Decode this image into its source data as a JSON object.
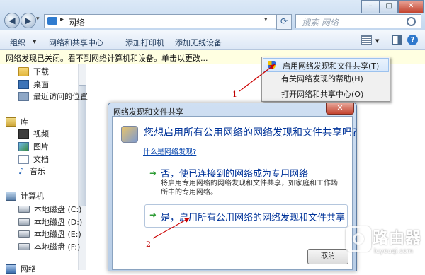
{
  "address_bar": {
    "path_label": "网络",
    "separator": "▸"
  },
  "search": {
    "placeholder": "搜索 网络"
  },
  "window_controls": {
    "minimize": "–",
    "maximize": "□",
    "close": "✕"
  },
  "toolbar": {
    "organize": "组织",
    "network_center": "网络和共享中心",
    "add_printer": "添加打印机",
    "add_wireless": "添加无线设备"
  },
  "infobar": {
    "text": "网络发现已关闭。看不到网络计算机和设备。单击以更改..."
  },
  "sidebar": {
    "items": [
      {
        "label": "下载",
        "icon": "folder-icon"
      },
      {
        "label": "桌面",
        "icon": "desktop-icon"
      },
      {
        "label": "最近访问的位置",
        "icon": "recent-places-icon"
      }
    ],
    "libraries": {
      "label": "库",
      "items": [
        {
          "label": "视频",
          "icon": "video-icon"
        },
        {
          "label": "图片",
          "icon": "pictures-icon"
        },
        {
          "label": "文档",
          "icon": "documents-icon"
        },
        {
          "label": "音乐",
          "icon": "music-icon"
        }
      ]
    },
    "computer": {
      "label": "计算机",
      "disks": [
        {
          "label": "本地磁盘 (C:)"
        },
        {
          "label": "本地磁盘 (D:)"
        },
        {
          "label": "本地磁盘 (E:)"
        },
        {
          "label": "本地磁盘 (F:)"
        }
      ]
    },
    "network": {
      "label": "网络"
    }
  },
  "context_menu": {
    "items": [
      "启用网络发现和文件共享(T)",
      "有关网络发现的帮助(H)",
      "打开网络和共享中心(O)"
    ]
  },
  "dialog": {
    "title": "网络发现和文件共享",
    "close": "✕",
    "question": "您想启用所有公用网络的网络发现和文件共享吗?",
    "help_link": "什么是网络发现?",
    "option_private": {
      "title": "否，使已连接到的网络成为专用网络",
      "description": "将启用专用网络的网络发现和文件共享，如家庭和工作场所中的专用网络。"
    },
    "option_public": {
      "title": "是，启用所有公用网络的网络发现和文件共享"
    },
    "cancel": "取消"
  },
  "annotations": {
    "marker_1": "1",
    "marker_2": "2",
    "color": "#cc0000"
  },
  "watermark": {
    "name": "路由器",
    "url": "luyouqi.com"
  }
}
